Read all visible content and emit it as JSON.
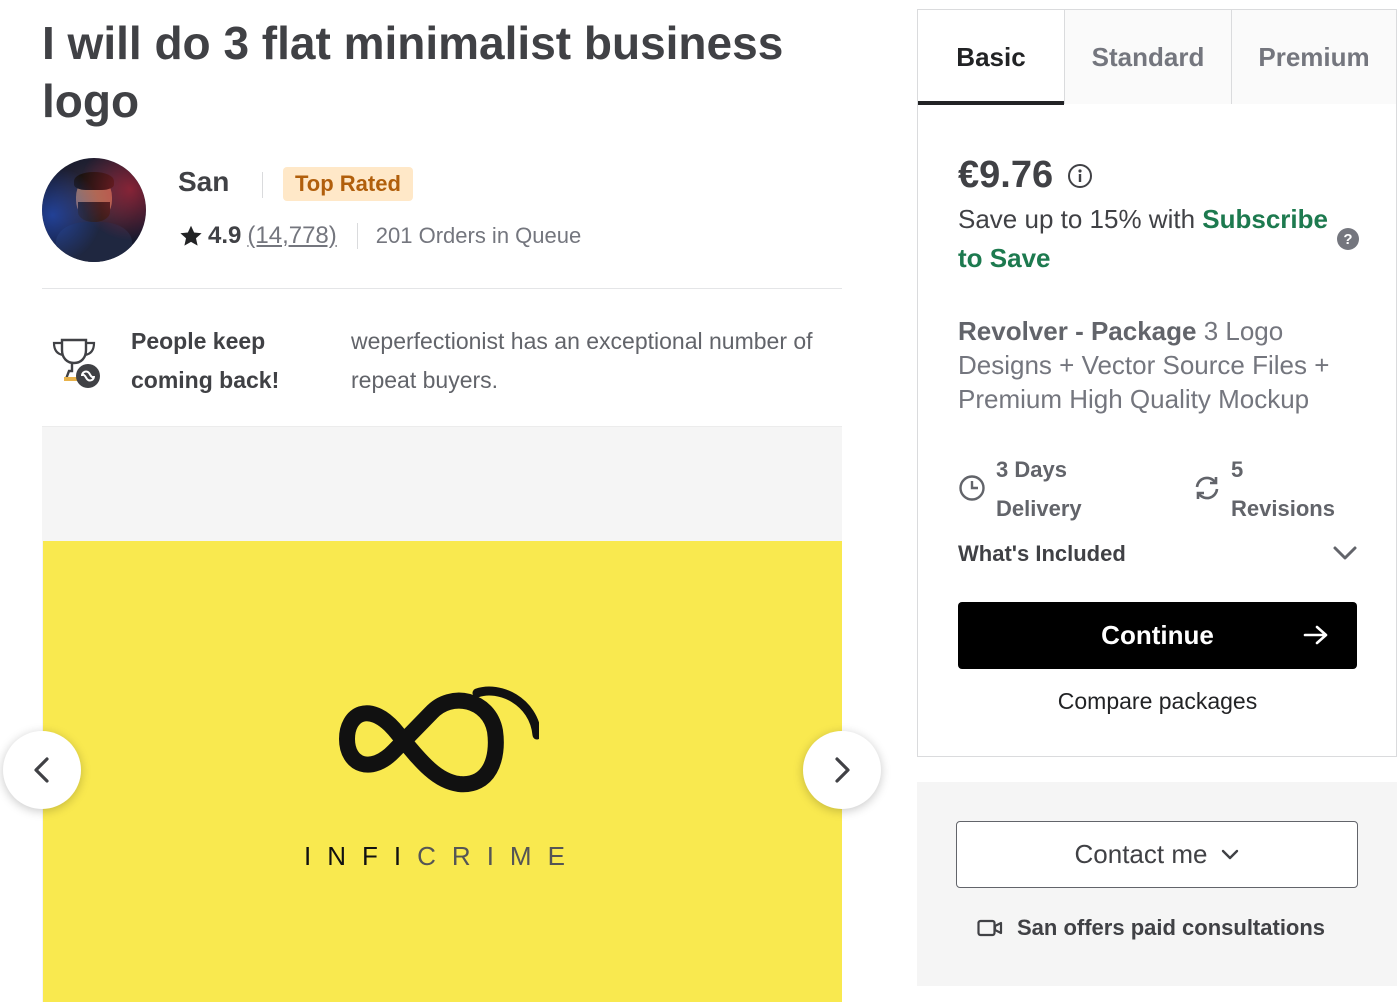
{
  "gig": {
    "title": "I will do 3 flat minimalist business logo"
  },
  "seller": {
    "name": "San",
    "badge": "Top Rated",
    "rating": "4.9",
    "review_count": "(14,778)",
    "queue": "201 Orders in Queue"
  },
  "highlight": {
    "title": "People keep coming back!",
    "description": "weperfectionist has an exceptional number of repeat buyers.",
    "icon": "trophy-icon"
  },
  "gallery": {
    "brand_part1": "INFI",
    "brand_part2": "CRIME",
    "background_color": "#f9e94f"
  },
  "package": {
    "tabs": [
      "Basic",
      "Standard",
      "Premium"
    ],
    "active_tab": "Basic",
    "price": "€9.76",
    "save_prefix": "Save up to 15% with ",
    "save_link": "Subscribe to Save",
    "name": "Revolver - Package",
    "description": " 3 Logo Designs + Vector Source Files + Premium High Quality Mockup",
    "delivery_value": "3 Days",
    "delivery_label": "Delivery",
    "revisions_value": "5",
    "revisions_label": "Revisions",
    "included_label": "What's Included",
    "continue_label": "Continue",
    "compare_label": "Compare packages"
  },
  "contact": {
    "button_label": "Contact me",
    "consult_text": "San offers paid consultations"
  },
  "colors": {
    "accent_green": "#1d7a4f",
    "badge_bg": "#ffe8c8",
    "badge_text": "#b15f0c"
  }
}
